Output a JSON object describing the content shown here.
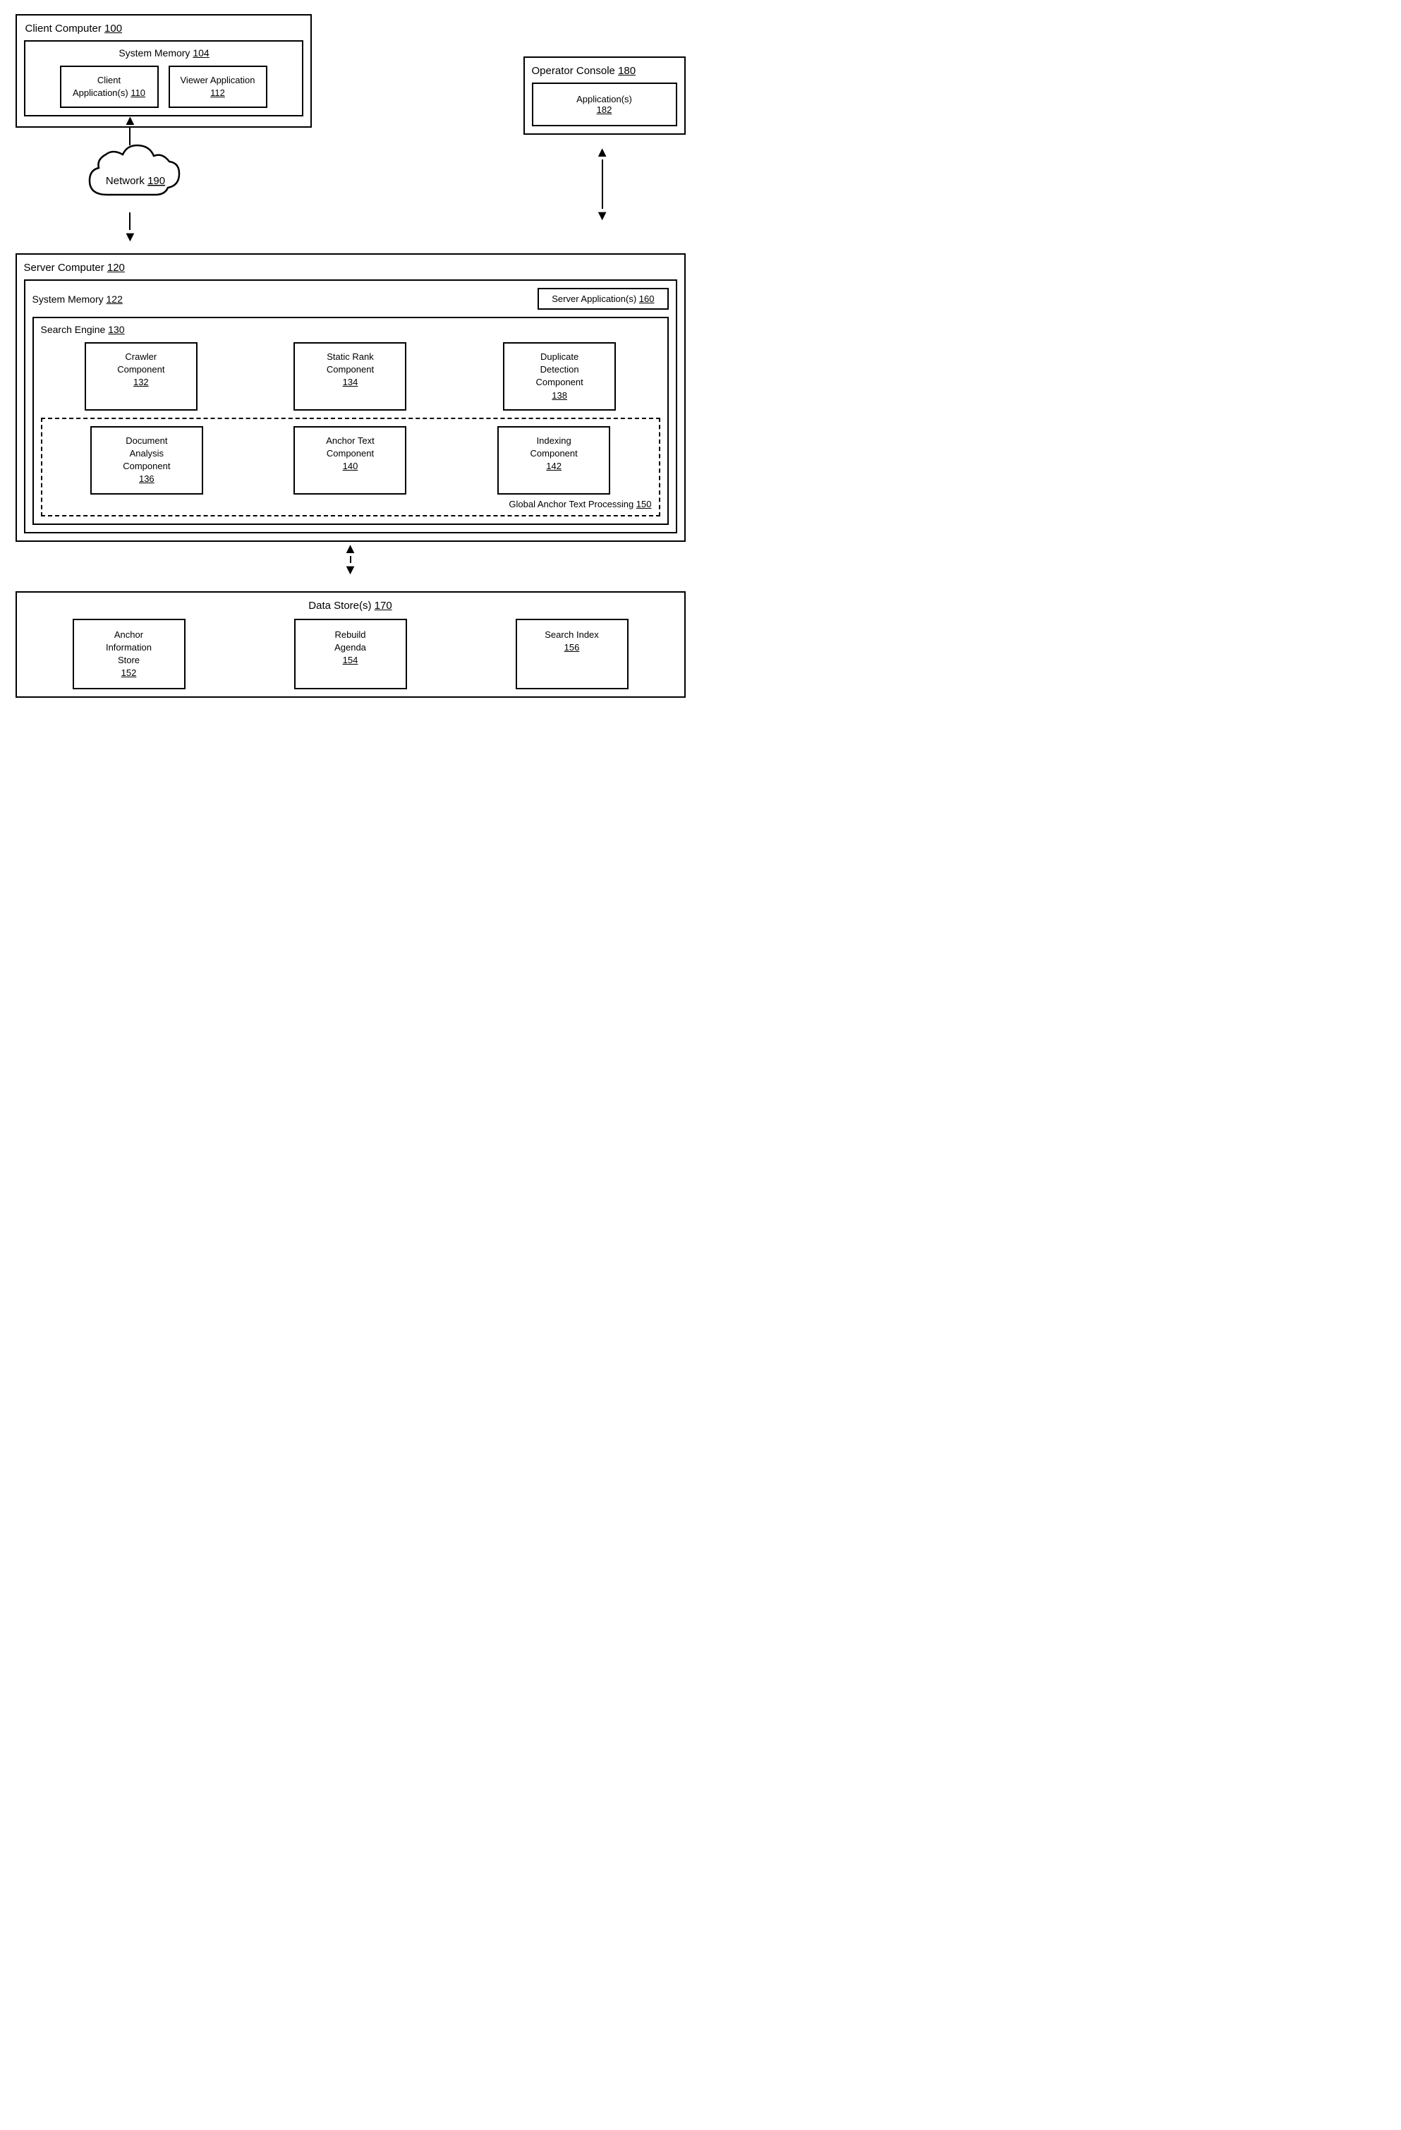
{
  "client_computer": {
    "label": "Client Computer",
    "number": "100",
    "system_memory": {
      "label": "System Memory",
      "number": "104",
      "client_app": {
        "label": "Client\nApplication(s)",
        "number": "110"
      },
      "viewer_app": {
        "label": "Viewer Application",
        "number": "112"
      }
    }
  },
  "operator_console": {
    "label": "Operator Console",
    "number": "180",
    "applications": {
      "label": "Application(s)",
      "number": "182"
    }
  },
  "network": {
    "label": "Network",
    "number": "190"
  },
  "server_computer": {
    "label": "Server Computer",
    "number": "120",
    "system_memory": {
      "label": "System Memory",
      "number": "122"
    },
    "server_applications": {
      "label": "Server Application(s)",
      "number": "160"
    },
    "search_engine": {
      "label": "Search Engine",
      "number": "130",
      "crawler": {
        "label": "Crawler\nComponent",
        "number": "132"
      },
      "static_rank": {
        "label": "Static Rank\nComponent",
        "number": "134"
      },
      "duplicate_detection": {
        "label": "Duplicate\nDetection\nComponent",
        "number": "138"
      }
    },
    "global_anchor": {
      "label": "Global Anchor Text Processing",
      "number": "150",
      "document_analysis": {
        "label": "Document\nAnalysis\nComponent",
        "number": "136"
      },
      "anchor_text": {
        "label": "Anchor Text\nComponent",
        "number": "140"
      },
      "indexing": {
        "label": "Indexing\nComponent",
        "number": "142"
      }
    }
  },
  "data_store": {
    "label": "Data Store(s)",
    "number": "170",
    "anchor_info": {
      "label": "Anchor\nInformation\nStore",
      "number": "152"
    },
    "rebuild_agenda": {
      "label": "Rebuild\nAgenda",
      "number": "154"
    },
    "search_index": {
      "label": "Search Index",
      "number": "156"
    }
  }
}
